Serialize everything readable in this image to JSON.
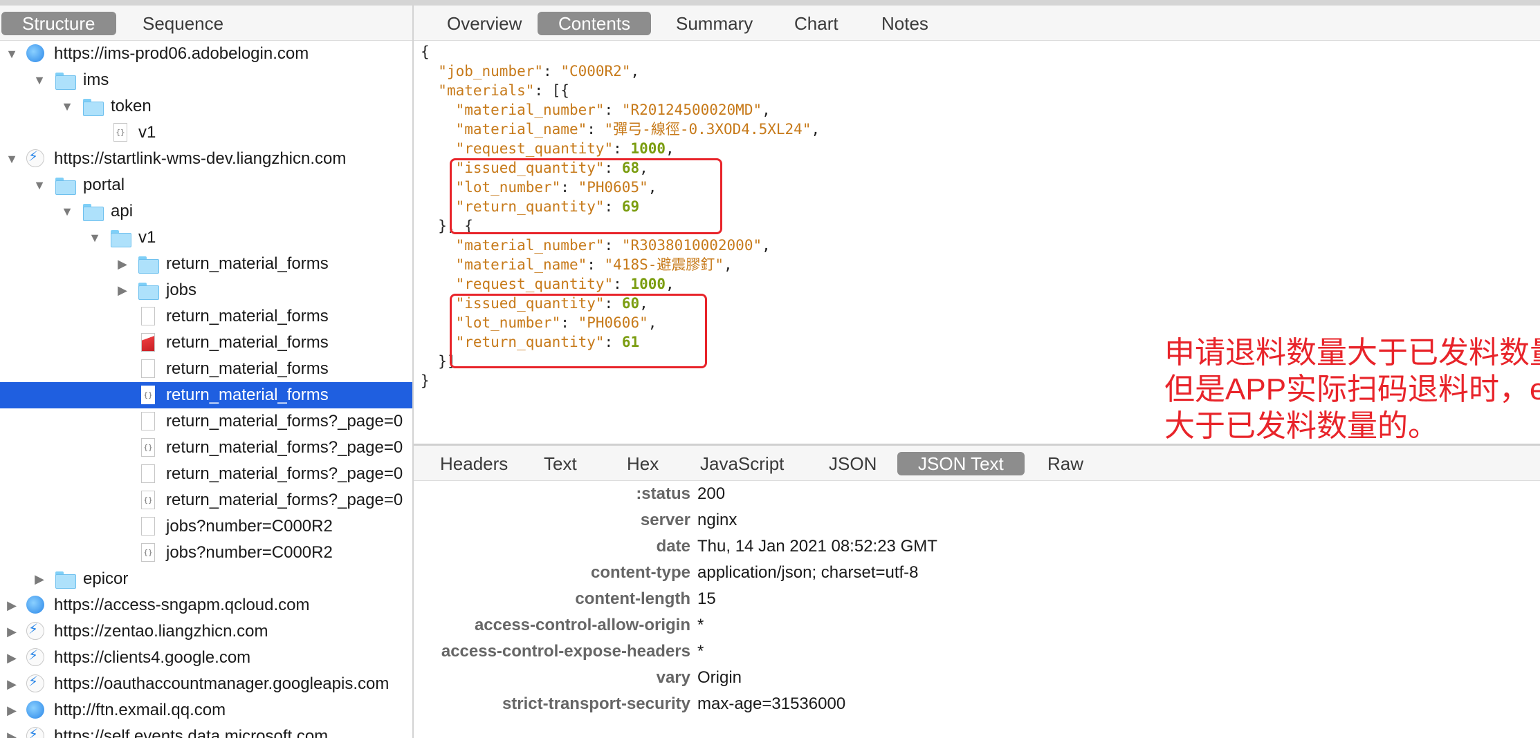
{
  "left_tabs": [
    "Structure",
    "Sequence"
  ],
  "tree": [
    {
      "label": "https://ims-prod06.adobelogin.com",
      "level": 0,
      "arrow": "down",
      "icon": "globe"
    },
    {
      "label": "ims",
      "level": 1,
      "arrow": "down",
      "icon": "folder"
    },
    {
      "label": "token",
      "level": 2,
      "arrow": "down",
      "icon": "folder"
    },
    {
      "label": "v1",
      "level": 3,
      "arrow": "",
      "icon": "json"
    },
    {
      "label": "https://startlink-wms-dev.liangzhicn.com",
      "level": 0,
      "arrow": "down",
      "icon": "bolt"
    },
    {
      "label": "portal",
      "level": 1,
      "arrow": "down",
      "icon": "folder"
    },
    {
      "label": "api",
      "level": 2,
      "arrow": "down",
      "icon": "folder"
    },
    {
      "label": "v1",
      "level": 3,
      "arrow": "down",
      "icon": "folder"
    },
    {
      "label": "return_material_forms",
      "level": 4,
      "arrow": "right",
      "icon": "folder"
    },
    {
      "label": "jobs",
      "level": 4,
      "arrow": "right",
      "icon": "folder"
    },
    {
      "label": "return_material_forms",
      "level": 4,
      "arrow": "",
      "icon": "doc"
    },
    {
      "label": "return_material_forms",
      "level": 4,
      "arrow": "",
      "icon": "err"
    },
    {
      "label": "return_material_forms",
      "level": 4,
      "arrow": "",
      "icon": "doc"
    },
    {
      "label": "return_material_forms",
      "level": 4,
      "arrow": "",
      "icon": "json",
      "selected": true
    },
    {
      "label": "return_material_forms?_page=0",
      "level": 4,
      "arrow": "",
      "icon": "doc"
    },
    {
      "label": "return_material_forms?_page=0",
      "level": 4,
      "arrow": "",
      "icon": "json"
    },
    {
      "label": "return_material_forms?_page=0",
      "level": 4,
      "arrow": "",
      "icon": "doc"
    },
    {
      "label": "return_material_forms?_page=0",
      "level": 4,
      "arrow": "",
      "icon": "json"
    },
    {
      "label": "jobs?number=C000R2",
      "level": 4,
      "arrow": "",
      "icon": "doc"
    },
    {
      "label": "jobs?number=C000R2",
      "level": 4,
      "arrow": "",
      "icon": "json"
    },
    {
      "label": "epicor",
      "level": 1,
      "arrow": "right",
      "icon": "folder"
    },
    {
      "label": "https://access-sngapm.qcloud.com",
      "level": 0,
      "arrow": "right",
      "icon": "globe"
    },
    {
      "label": "https://zentao.liangzhicn.com",
      "level": 0,
      "arrow": "right",
      "icon": "bolt"
    },
    {
      "label": "https://clients4.google.com",
      "level": 0,
      "arrow": "right",
      "icon": "bolt"
    },
    {
      "label": "https://oauthaccountmanager.googleapis.com",
      "level": 0,
      "arrow": "right",
      "icon": "bolt"
    },
    {
      "label": "http://ftn.exmail.qq.com",
      "level": 0,
      "arrow": "right",
      "icon": "globe"
    },
    {
      "label": "https://self.events.data.microsoft.com",
      "level": 0,
      "arrow": "right",
      "icon": "bolt"
    }
  ],
  "top_tabs": [
    "Overview",
    "Contents",
    "Summary",
    "Chart",
    "Notes"
  ],
  "top_active": 1,
  "code_lines": [
    [
      [
        "p",
        "{"
      ]
    ],
    [
      [
        "p",
        "  "
      ],
      [
        "k",
        "\"job_number\""
      ],
      [
        "p",
        ": "
      ],
      [
        "s",
        "\"C000R2\""
      ],
      [
        "p",
        ","
      ]
    ],
    [
      [
        "p",
        "  "
      ],
      [
        "k",
        "\"materials\""
      ],
      [
        "p",
        ": [{"
      ]
    ],
    [
      [
        "p",
        "    "
      ],
      [
        "k",
        "\"material_number\""
      ],
      [
        "p",
        ": "
      ],
      [
        "s",
        "\"R20124500020MD\""
      ],
      [
        "p",
        ","
      ]
    ],
    [
      [
        "p",
        "    "
      ],
      [
        "k",
        "\"material_name\""
      ],
      [
        "p",
        ": "
      ],
      [
        "s",
        "\"彈弓-線徑-0.3XOD4.5XL24\""
      ],
      [
        "p",
        ","
      ]
    ],
    [
      [
        "p",
        "    "
      ],
      [
        "k",
        "\"request_quantity\""
      ],
      [
        "p",
        ": "
      ],
      [
        "n",
        "1000"
      ],
      [
        "p",
        ","
      ]
    ],
    [
      [
        "p",
        "    "
      ],
      [
        "k",
        "\"issued_quantity\""
      ],
      [
        "p",
        ": "
      ],
      [
        "n",
        "68"
      ],
      [
        "p",
        ","
      ]
    ],
    [
      [
        "p",
        "    "
      ],
      [
        "k",
        "\"lot_number\""
      ],
      [
        "p",
        ": "
      ],
      [
        "s",
        "\"PH0605\""
      ],
      [
        "p",
        ","
      ]
    ],
    [
      [
        "p",
        "    "
      ],
      [
        "k",
        "\"return_quantity\""
      ],
      [
        "p",
        ": "
      ],
      [
        "n",
        "69"
      ]
    ],
    [
      [
        "p",
        "  }, {"
      ]
    ],
    [
      [
        "p",
        "    "
      ],
      [
        "k",
        "\"material_number\""
      ],
      [
        "p",
        ": "
      ],
      [
        "s",
        "\"R3038010002000\""
      ],
      [
        "p",
        ","
      ]
    ],
    [
      [
        "p",
        "    "
      ],
      [
        "k",
        "\"material_name\""
      ],
      [
        "p",
        ": "
      ],
      [
        "s",
        "\"418S-避震膠釘\""
      ],
      [
        "p",
        ","
      ]
    ],
    [
      [
        "p",
        "    "
      ],
      [
        "k",
        "\"request_quantity\""
      ],
      [
        "p",
        ": "
      ],
      [
        "n",
        "1000"
      ],
      [
        "p",
        ","
      ]
    ],
    [
      [
        "p",
        "    "
      ],
      [
        "k",
        "\"issued_quantity\""
      ],
      [
        "p",
        ": "
      ],
      [
        "n",
        "60"
      ],
      [
        "p",
        ","
      ]
    ],
    [
      [
        "p",
        "    "
      ],
      [
        "k",
        "\"lot_number\""
      ],
      [
        "p",
        ": "
      ],
      [
        "s",
        "\"PH0606\""
      ],
      [
        "p",
        ","
      ]
    ],
    [
      [
        "p",
        "    "
      ],
      [
        "k",
        "\"return_quantity\""
      ],
      [
        "p",
        ": "
      ],
      [
        "n",
        "61"
      ]
    ],
    [
      [
        "p",
        "  }]"
      ]
    ],
    [
      [
        "p",
        "}"
      ]
    ]
  ],
  "annotation": [
    "申请退料数量大于已发料数量，这里可以新增成功，",
    "但是APP实际扫码退料时，epicor是不允许退料数量",
    "大于已发料数量的。"
  ],
  "bottom_tabs": [
    "Headers",
    "Text",
    "Hex",
    "JavaScript",
    "JSON",
    "JSON Text",
    "Raw"
  ],
  "bottom_active": 5,
  "headers": [
    {
      "key": ":status",
      "value": "200"
    },
    {
      "key": "server",
      "value": "nginx"
    },
    {
      "key": "date",
      "value": "Thu, 14 Jan 2021 08:52:23 GMT"
    },
    {
      "key": "content-type",
      "value": "application/json; charset=utf-8"
    },
    {
      "key": "content-length",
      "value": "15"
    },
    {
      "key": "access-control-allow-origin",
      "value": "*"
    },
    {
      "key": "access-control-expose-headers",
      "value": "*"
    },
    {
      "key": "vary",
      "value": "Origin"
    },
    {
      "key": "strict-transport-security",
      "value": "max-age=31536000"
    }
  ],
  "colors": {
    "accent": "#1f5fe0",
    "annotation": "#e8242a",
    "json_key": "#c77a1a",
    "json_number": "#7b9d10"
  }
}
